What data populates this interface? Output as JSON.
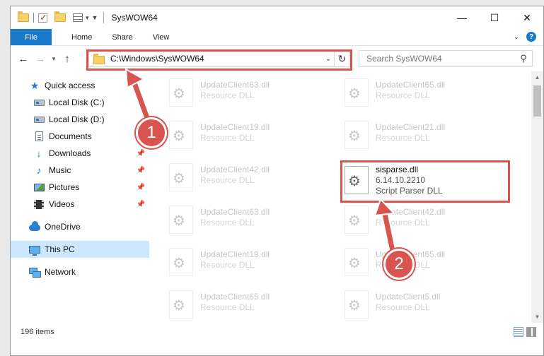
{
  "window": {
    "title": "SysWOW64"
  },
  "ribbon": {
    "tabs": [
      "File",
      "Home",
      "Share",
      "View"
    ]
  },
  "address": {
    "path": "C:\\Windows\\SysWOW64"
  },
  "search": {
    "placeholder": "Search SysWOW64"
  },
  "nav": {
    "items": [
      {
        "label": "Quick access",
        "icon": "star-icon"
      },
      {
        "label": "Local Disk (C:)",
        "icon": "drive-icon"
      },
      {
        "label": "Local Disk (D:)",
        "icon": "drive-icon"
      },
      {
        "label": "Documents",
        "icon": "documents-icon"
      },
      {
        "label": "Downloads",
        "icon": "downloads-icon",
        "pinned": true
      },
      {
        "label": "Music",
        "icon": "music-icon",
        "pinned": true
      },
      {
        "label": "Pictures",
        "icon": "pictures-icon",
        "pinned": true
      },
      {
        "label": "Videos",
        "icon": "videos-icon",
        "pinned": true
      },
      {
        "label": "OneDrive",
        "icon": "onedrive-icon"
      },
      {
        "label": "This PC",
        "icon": "this-pc-icon",
        "selected": true
      },
      {
        "label": "Network",
        "icon": "network-icon"
      }
    ]
  },
  "files": [
    {
      "name": "UpdateClient63.dll",
      "type": "Resource DLL"
    },
    {
      "name": "UpdateClient65.dll",
      "type": "Resource DLL"
    },
    {
      "name": "UpdateClient19.dll",
      "type": "Resource DLL"
    },
    {
      "name": "UpdateClient21.dll",
      "type": "Resource DLL"
    },
    {
      "name": "UpdateClient42.dll",
      "type": "Resource DLL"
    },
    {
      "name": "sisparse.dll",
      "version": "6.14.10.2210",
      "type": "Script Parser DLL"
    },
    {
      "name": "UpdateClient63.dll",
      "type": "Resource DLL"
    },
    {
      "name": "UpdateClient42.dll",
      "type": "Resource DLL"
    },
    {
      "name": "UpdateClient19.dll",
      "type": "Resource DLL"
    },
    {
      "name": "UpdateClient65.dll",
      "type": "Resource DLL"
    },
    {
      "name": "UpdateClient65.dll",
      "type": "Resource DLL"
    },
    {
      "name": "UpdateClient5.dll",
      "type": "Resource DLL"
    }
  ],
  "status": {
    "item_count": "196 items"
  },
  "annotations": {
    "step1": "1",
    "step2": "2",
    "color": "#d9534f"
  }
}
